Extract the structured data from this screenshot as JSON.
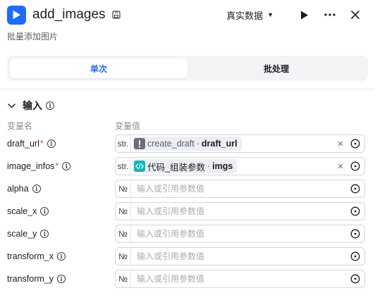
{
  "header": {
    "title": "add_images",
    "subtitle": "批量添加图片",
    "mode_label": "真实数据",
    "app_icon": "play-square-icon",
    "edit_icon": "save-edit-icon",
    "accent": "#1f6bff"
  },
  "tabs": [
    {
      "label": "单次",
      "active": true
    },
    {
      "label": "批处理",
      "active": false
    }
  ],
  "inputs_section": {
    "label": "输入",
    "col_name": "变量名",
    "col_value": "变量值"
  },
  "fields": [
    {
      "name": "draft_url",
      "required": "*",
      "type": "str.",
      "ref_node": "create_draft",
      "ref_output": "draft_url",
      "node_color": "#6b6e78"
    },
    {
      "name": "image_infos",
      "required": "*",
      "type": "str.",
      "ref_node": "代码_组装参数",
      "ref_output": "imgs",
      "node_color": "#0fb8b8"
    },
    {
      "name": "alpha",
      "type": "№",
      "placeholder": "输入或引用参数值"
    },
    {
      "name": "scale_x",
      "type": "№",
      "placeholder": "输入或引用参数值"
    },
    {
      "name": "scale_y",
      "type": "№",
      "placeholder": "输入或引用参数值"
    },
    {
      "name": "transform_x",
      "type": "№",
      "placeholder": "输入或引用参数值"
    },
    {
      "name": "transform_y",
      "type": "№",
      "placeholder": "输入或引用参数值"
    }
  ]
}
